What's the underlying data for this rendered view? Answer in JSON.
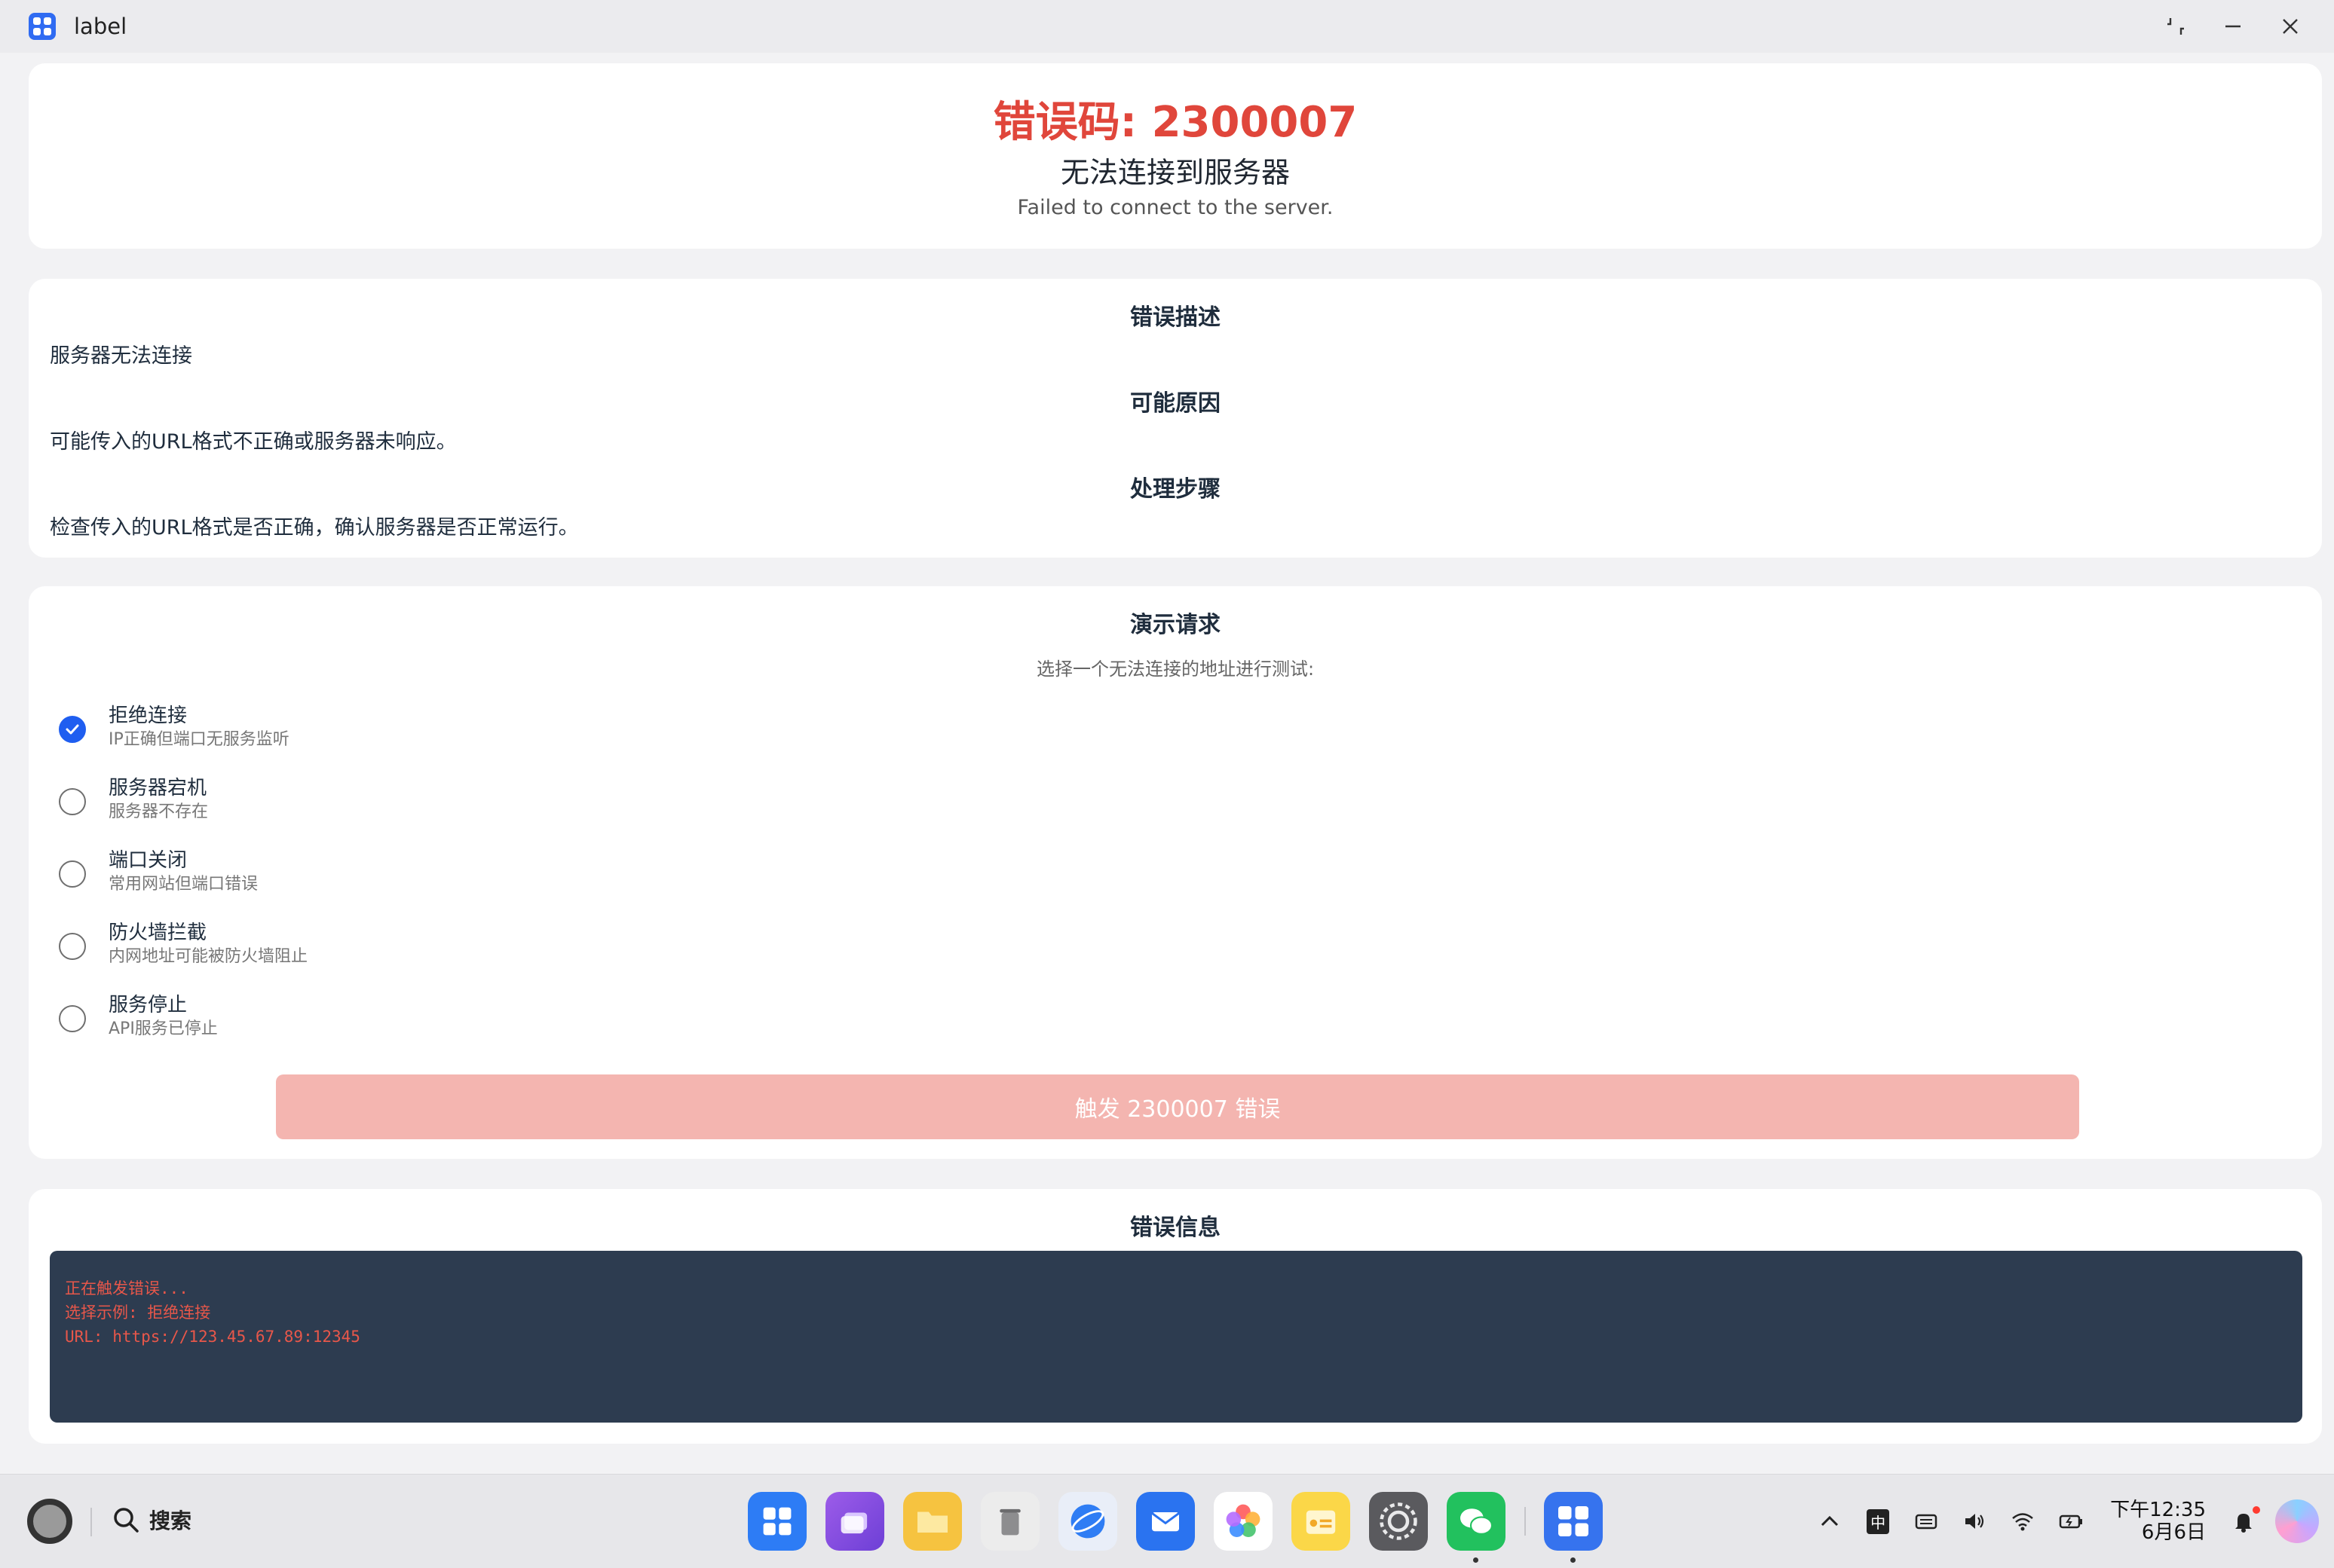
{
  "window": {
    "title": "label"
  },
  "header": {
    "error_code": "错误码: 2300007",
    "title": "无法连接到服务器",
    "subtitle": "Failed to connect to the server."
  },
  "description": {
    "desc_title": "错误描述",
    "desc_text": "服务器无法连接",
    "cause_title": "可能原因",
    "cause_text": "可能传入的URL格式不正确或服务器未响应。",
    "steps_title": "处理步骤",
    "steps_text": "检查传入的URL格式是否正确，确认服务器是否正常运行。"
  },
  "demo": {
    "title": "演示请求",
    "hint": "选择一个无法连接的地址进行测试:",
    "options": [
      {
        "title": "拒绝连接",
        "sub": "IP正确但端口无服务监听",
        "checked": true
      },
      {
        "title": "服务器宕机",
        "sub": "服务器不存在",
        "checked": false
      },
      {
        "title": "端口关闭",
        "sub": "常用网站但端口错误",
        "checked": false
      },
      {
        "title": "防火墙拦截",
        "sub": "内网地址可能被防火墙阻止",
        "checked": false
      },
      {
        "title": "服务停止",
        "sub": "API服务已停止",
        "checked": false
      }
    ],
    "trigger_label": "触发 2300007 错误"
  },
  "info": {
    "title": "错误信息",
    "lines": [
      "正在触发错误...",
      "选择示例: 拒绝连接",
      "URL: https://123.45.67.89:12345"
    ]
  },
  "taskbar": {
    "search_label": "搜索",
    "dock": [
      "grid-app-icon",
      "multitask-icon",
      "files-icon",
      "trash-icon",
      "browser-icon",
      "mail-icon",
      "photos-icon",
      "notes-icon",
      "settings-icon",
      "wechat-icon",
      "label-app-icon"
    ],
    "ime_label": "中",
    "time": "下午12:35",
    "date": "6月6日"
  },
  "colors": {
    "accent": "#1f5ef0",
    "error": "#e0463b",
    "button_disabled": "#f4b5b0",
    "console_bg": "#2d3c50"
  }
}
